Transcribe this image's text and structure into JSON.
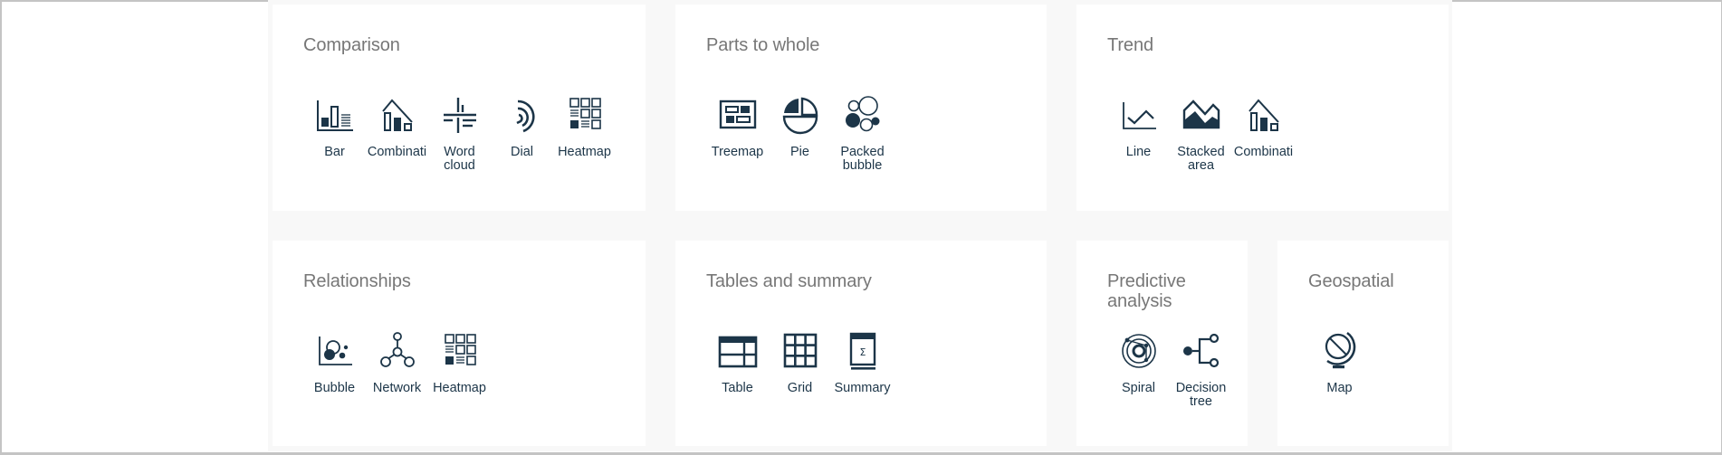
{
  "colors": {
    "icon": "#1c3548",
    "title": "#777777",
    "panel_bg": "#f8f8f8",
    "card_bg": "#ffffff"
  },
  "cards": [
    {
      "title": "Comparison",
      "items": [
        {
          "label": "Bar",
          "icon": "bar-chart-icon"
        },
        {
          "label": "Combinati",
          "icon": "combination-chart-icon"
        },
        {
          "label": "Word\ncloud",
          "icon": "word-cloud-icon"
        },
        {
          "label": "Dial",
          "icon": "dial-icon"
        },
        {
          "label": "Heatmap",
          "icon": "heatmap-icon"
        }
      ]
    },
    {
      "title": "Parts to whole",
      "items": [
        {
          "label": "Treemap",
          "icon": "treemap-icon"
        },
        {
          "label": "Pie",
          "icon": "pie-chart-icon"
        },
        {
          "label": "Packed\nbubble",
          "icon": "packed-bubble-icon"
        }
      ]
    },
    {
      "title": "Trend",
      "items": [
        {
          "label": "Line",
          "icon": "line-chart-icon"
        },
        {
          "label": "Stacked\narea",
          "icon": "stacked-area-icon"
        },
        {
          "label": "Combinati",
          "icon": "combination-chart-icon"
        }
      ]
    },
    {
      "title": "Relationships",
      "items": [
        {
          "label": "Bubble",
          "icon": "bubble-chart-icon"
        },
        {
          "label": "Network",
          "icon": "network-icon"
        },
        {
          "label": "Heatmap",
          "icon": "heatmap-icon"
        }
      ]
    },
    {
      "title": "Tables and summary",
      "items": [
        {
          "label": "Table",
          "icon": "table-icon"
        },
        {
          "label": "Grid",
          "icon": "grid-icon"
        },
        {
          "label": "Summary",
          "icon": "summary-icon"
        }
      ]
    },
    {
      "title": "Predictive\nanalysis",
      "items": [
        {
          "label": "Spiral",
          "icon": "spiral-icon"
        },
        {
          "label": "Decision\ntree",
          "icon": "decision-tree-icon"
        }
      ]
    },
    {
      "title": "Geospatial",
      "items": [
        {
          "label": "Map",
          "icon": "globe-map-icon"
        }
      ]
    }
  ]
}
